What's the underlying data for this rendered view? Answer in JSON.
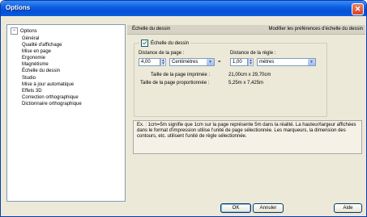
{
  "window": {
    "title": "Options"
  },
  "tree": {
    "root": "Options",
    "root_toggle": "−",
    "items": [
      "Général",
      "Qualité d'affichage",
      "Mise en page",
      "Ergonomie",
      "Magnétisme",
      "Échelle du dessin",
      "Studio",
      "Mise à jour automatique",
      "Effets 3D",
      "Correction orthographique",
      "Dictionnaire orthographique"
    ],
    "selected_index": 5
  },
  "panel": {
    "header_title": "Échelle du dessin",
    "header_desc": "Modifier les préférences d'échelle du dessin",
    "checkbox_label": "Échelle du dessin",
    "checkbox_checked": true,
    "page_distance_label": "Distance de la page :",
    "page_distance_value": "4,00",
    "page_unit": "Centimètres",
    "times": "=",
    "rule_distance_label": "Distance de la règle :",
    "rule_distance_value": "1,00",
    "rule_unit": "mètres",
    "printed_size_label": "Taille de la page imprimée :",
    "printed_size_value": "21,00cm x 29,70cm",
    "proportional_size_label": "Taille de la page proportionnée :",
    "proportional_size_value": "5,25m x 7,425m",
    "example_text": "Ex. : 1cm=5m signifie que 1cm sur la page représente 5m dans la réalité. La hauteur/largeur affichées dans le format d'impression utilise l'unité de page sélectionnée. Les marqueurs, la dimension des contours, etc. utilisent l'unité de règle sélectionnée."
  },
  "buttons": {
    "ok": "OK",
    "cancel": "Annuler",
    "help": "Aide"
  },
  "colors": {
    "title_bar": "#0a5ce0",
    "close": "#d4441f"
  }
}
